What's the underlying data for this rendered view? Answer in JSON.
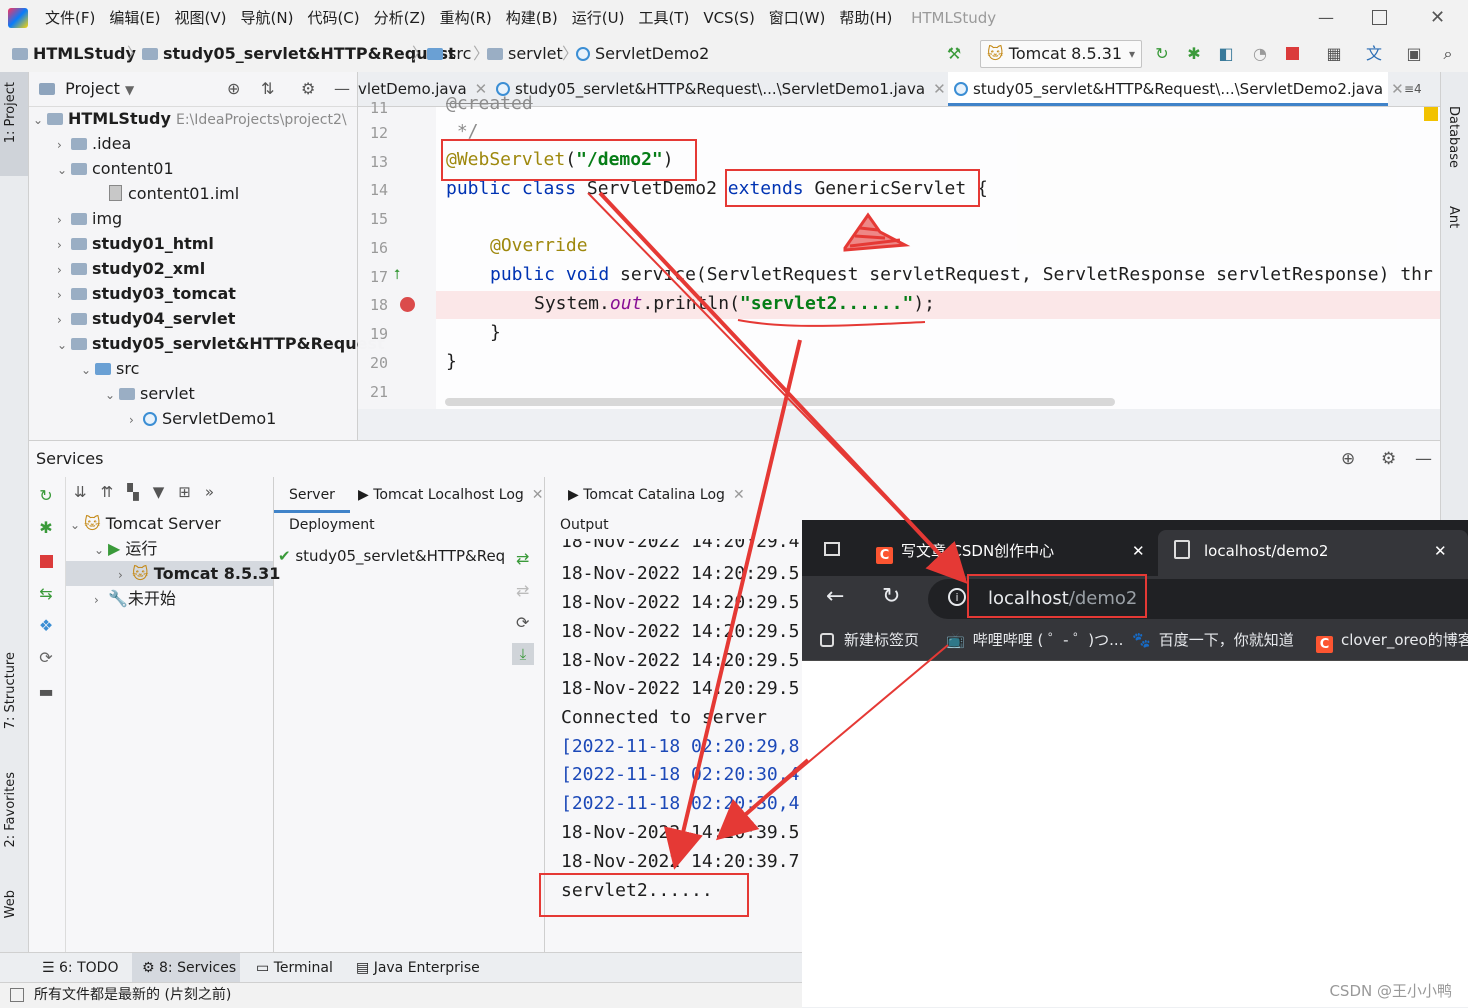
{
  "menu": {
    "items": [
      "文件(F)",
      "编辑(E)",
      "视图(V)",
      "导航(N)",
      "代码(C)",
      "分析(Z)",
      "重构(R)",
      "构建(B)",
      "运行(U)",
      "工具(T)",
      "VCS(S)",
      "窗口(W)",
      "帮助(H)"
    ],
    "project_name": "HTMLStudy"
  },
  "navbar": {
    "crumbs": [
      "HTMLStudy",
      "study05_servlet&HTTP&Request",
      "src",
      "servlet",
      "ServletDemo2"
    ],
    "run_config": "Tomcat 8.5.31"
  },
  "side_tabs": {
    "left": [
      "1: Project",
      "7: Structure",
      "2: Favorites",
      "Web"
    ],
    "right": [
      "Database",
      "Ant"
    ]
  },
  "project_panel": {
    "title": "Project",
    "tree": [
      {
        "label": "HTMLStudy",
        "path": "E:\\IdeaProjects\\project2\\"
      },
      {
        "label": ".idea"
      },
      {
        "label": "content01"
      },
      {
        "label": "content01.iml"
      },
      {
        "label": "img"
      },
      {
        "label": "study01_html"
      },
      {
        "label": "study02_xml"
      },
      {
        "label": "study03_tomcat"
      },
      {
        "label": "study04_servlet"
      },
      {
        "label": "study05_servlet&HTTP&Request"
      },
      {
        "label": "src"
      },
      {
        "label": "servlet"
      },
      {
        "label": "ServletDemo1"
      }
    ]
  },
  "editor": {
    "tabs": [
      "vletDemo.java",
      "study05_servlet&HTTP&Request\\...\\ServletDemo1.java",
      "study05_servlet&HTTP&Request\\...\\ServletDemo2.java"
    ],
    "tab_overflow": "≡4",
    "line_numbers": [
      "11",
      "12",
      "13",
      "14",
      "15",
      "16",
      "17",
      "18",
      "19",
      "20",
      "21"
    ],
    "code": {
      "l11": "@created",
      "l12": " */",
      "l13_ann": "@WebServlet",
      "l13_open": "(",
      "l13_str": "\"/demo2\"",
      "l13_close": ")",
      "l14_kw": "public class",
      "l14_name": " ServletDemo2 ",
      "l14_ext": "extends",
      "l14_sup": " GenericServlet",
      "l14_brace": " {",
      "l16": "@Override",
      "l17_kw": "public void",
      "l17_rest": " service(ServletRequest servletRequest, ServletResponse servletResponse) thr",
      "l18_pre": "System.",
      "l18_fld": "out",
      "l18_mid": ".println(",
      "l18_str": "\"servlet2......\"",
      "l18_end": ");",
      "l19": "}",
      "l20": "}"
    }
  },
  "services": {
    "title": "Services",
    "tree": {
      "server": "Tomcat Server",
      "running": "运行",
      "instance": "Tomcat 8.5.31",
      "not_started": "未开始"
    },
    "tabs": [
      "Server",
      "Tomcat Localhost Log",
      "Tomcat Catalina Log"
    ],
    "deployment_header": "Deployment",
    "deployment_item": "study05_servlet&HTTP&Req",
    "output_header": "Output",
    "output_lines": [
      "18-Nov-2022 14:20:29.4",
      "18-Nov-2022 14:20:29.5",
      "18-Nov-2022 14:20:29.5",
      "18-Nov-2022 14:20:29.5",
      "18-Nov-2022 14:20:29.5",
      "18-Nov-2022 14:20:29.5",
      "Connected to server",
      "[2022-11-18 02:20:29,8",
      "[2022-11-18 02:20:30,4",
      "[2022-11-18 02:20:30,4",
      "18-Nov-2022 14:20:39.5",
      "18-Nov-2022 14:20:39.7",
      "servlet2......"
    ]
  },
  "bottom_tabs": [
    "6: TODO",
    "8: Services",
    "Terminal",
    "Java Enterprise"
  ],
  "status": "所有文件都是最新的 (片刻之前)",
  "browser": {
    "tabs": [
      "写文章-CSDN创作中心",
      "localhost/demo2"
    ],
    "url_host": "localhost",
    "url_path": "/demo2",
    "bookmarks": [
      "新建标签页",
      "哔哩哔哩 ( ゜- ゜)つ...",
      "百度一下，你就知道",
      "clover_oreo的博客"
    ]
  },
  "watermark": "CSDN @王小小鸭",
  "colors": {
    "annotation_red": "#e53935",
    "keyword": "#0033b3",
    "string": "#067d17"
  }
}
